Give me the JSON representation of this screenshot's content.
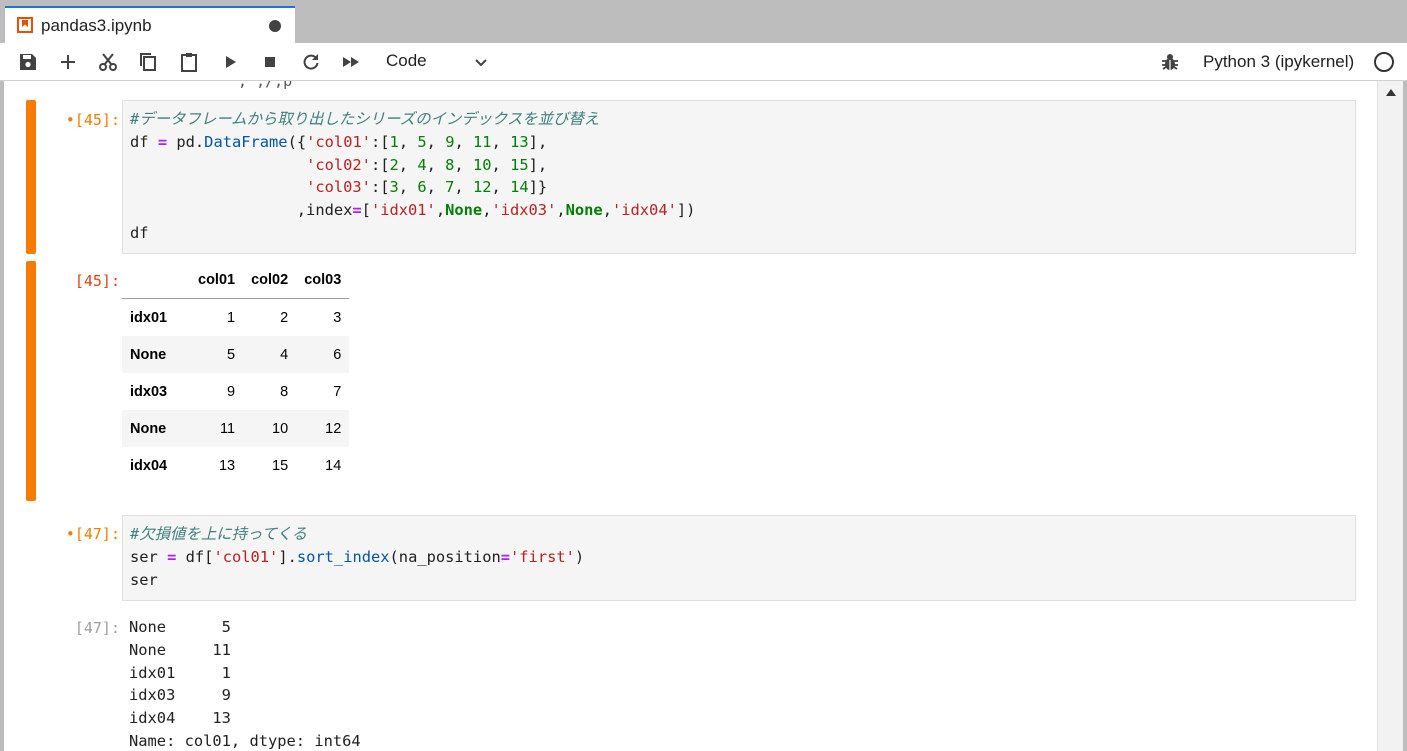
{
  "tab": {
    "title": "pandas3.ipynb"
  },
  "toolbar": {
    "cell_type": "Code",
    "kernel_name": "Python 3 (ipykernel)"
  },
  "top_fragment": "',';/;p",
  "cells": [
    {
      "prompt": "•[45]:",
      "code_lines": [
        [
          {
            "t": "#データフレームから取り出したシリーズのインデックスを並び替え",
            "c": "cm"
          }
        ],
        [
          {
            "t": "df ",
            "c": ""
          },
          {
            "t": "=",
            "c": "op"
          },
          {
            "t": " pd.",
            "c": ""
          },
          {
            "t": "DataFrame",
            "c": "fn"
          },
          {
            "t": "({",
            "c": ""
          },
          {
            "t": "'col01'",
            "c": "str"
          },
          {
            "t": ":[",
            "c": ""
          },
          {
            "t": "1",
            "c": "num"
          },
          {
            "t": ", ",
            "c": ""
          },
          {
            "t": "5",
            "c": "num"
          },
          {
            "t": ", ",
            "c": ""
          },
          {
            "t": "9",
            "c": "num"
          },
          {
            "t": ", ",
            "c": ""
          },
          {
            "t": "11",
            "c": "num"
          },
          {
            "t": ", ",
            "c": ""
          },
          {
            "t": "13",
            "c": "num"
          },
          {
            "t": "],",
            "c": ""
          }
        ],
        [
          {
            "t": "                   ",
            "c": ""
          },
          {
            "t": "'col02'",
            "c": "str"
          },
          {
            "t": ":[",
            "c": ""
          },
          {
            "t": "2",
            "c": "num"
          },
          {
            "t": ", ",
            "c": ""
          },
          {
            "t": "4",
            "c": "num"
          },
          {
            "t": ", ",
            "c": ""
          },
          {
            "t": "8",
            "c": "num"
          },
          {
            "t": ", ",
            "c": ""
          },
          {
            "t": "10",
            "c": "num"
          },
          {
            "t": ", ",
            "c": ""
          },
          {
            "t": "15",
            "c": "num"
          },
          {
            "t": "],",
            "c": ""
          }
        ],
        [
          {
            "t": "                   ",
            "c": ""
          },
          {
            "t": "'col03'",
            "c": "str"
          },
          {
            "t": ":[",
            "c": ""
          },
          {
            "t": "3",
            "c": "num"
          },
          {
            "t": ", ",
            "c": ""
          },
          {
            "t": "6",
            "c": "num"
          },
          {
            "t": ", ",
            "c": ""
          },
          {
            "t": "7",
            "c": "num"
          },
          {
            "t": ", ",
            "c": ""
          },
          {
            "t": "12",
            "c": "num"
          },
          {
            "t": ", ",
            "c": ""
          },
          {
            "t": "14",
            "c": "num"
          },
          {
            "t": "]}",
            "c": ""
          }
        ],
        [
          {
            "t": "                  ,index",
            "c": ""
          },
          {
            "t": "=",
            "c": "op"
          },
          {
            "t": "[",
            "c": ""
          },
          {
            "t": "'idx01'",
            "c": "str"
          },
          {
            "t": ",",
            "c": ""
          },
          {
            "t": "None",
            "c": "kw"
          },
          {
            "t": ",",
            "c": ""
          },
          {
            "t": "'idx03'",
            "c": "str"
          },
          {
            "t": ",",
            "c": ""
          },
          {
            "t": "None",
            "c": "kw"
          },
          {
            "t": ",",
            "c": ""
          },
          {
            "t": "'idx04'",
            "c": "str"
          },
          {
            "t": "])",
            "c": ""
          }
        ],
        [
          {
            "t": "df",
            "c": ""
          }
        ]
      ],
      "output_prompt": "[45]:",
      "output_table": {
        "columns": [
          "col01",
          "col02",
          "col03"
        ],
        "rows": [
          {
            "index": "idx01",
            "values": [
              "1",
              "2",
              "3"
            ]
          },
          {
            "index": "None",
            "values": [
              "5",
              "4",
              "6"
            ]
          },
          {
            "index": "idx03",
            "values": [
              "9",
              "8",
              "7"
            ]
          },
          {
            "index": "None",
            "values": [
              "11",
              "10",
              "12"
            ]
          },
          {
            "index": "idx04",
            "values": [
              "13",
              "15",
              "14"
            ]
          }
        ]
      }
    },
    {
      "prompt": "•[47]:",
      "code_lines": [
        [
          {
            "t": "#欠損値を上に持ってくる",
            "c": "cm"
          }
        ],
        [
          {
            "t": "ser ",
            "c": ""
          },
          {
            "t": "=",
            "c": "op"
          },
          {
            "t": " df[",
            "c": ""
          },
          {
            "t": "'col01'",
            "c": "str"
          },
          {
            "t": "].",
            "c": ""
          },
          {
            "t": "sort_index",
            "c": "fn"
          },
          {
            "t": "(na_position",
            "c": ""
          },
          {
            "t": "=",
            "c": "op"
          },
          {
            "t": "'first'",
            "c": "str"
          },
          {
            "t": ")",
            "c": ""
          }
        ],
        [
          {
            "t": "ser",
            "c": ""
          }
        ]
      ],
      "output_prompt": "[47]:",
      "output_text": "None      5\nNone     11\nidx01     1\nidx03     9\nidx04    13\nName: col01, dtype: int64"
    }
  ]
}
